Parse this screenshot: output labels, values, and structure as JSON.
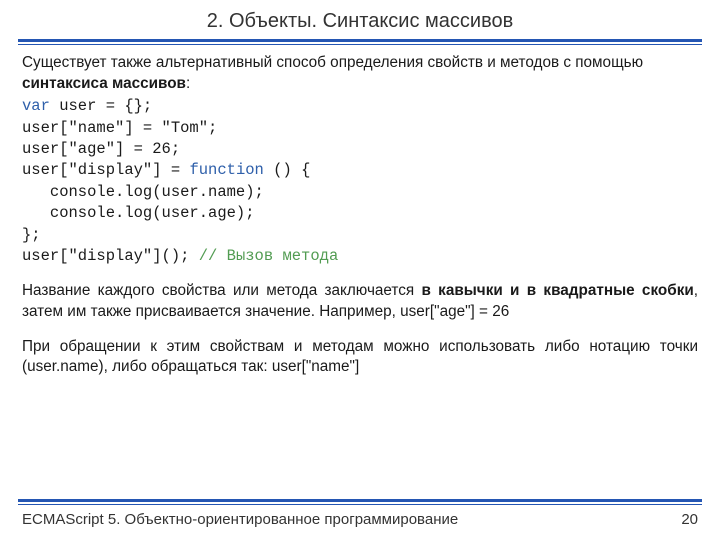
{
  "title": "2. Объекты. Синтаксис массивов",
  "intro_a": "Существует также альтернативный способ определения свойств и методов с помощью ",
  "intro_b": "синтаксиса массивов",
  "intro_c": ":",
  "code": {
    "l1a": "var",
    "l1b": " user = {};",
    "l2": "user[\"name\"] = \"Tom\";",
    "l3": "user[\"age\"] = 26;",
    "l4a": "user[\"display\"] = ",
    "l4b": "function",
    "l4c": " () {",
    "l5": "   console.log(user.name);",
    "l6": "   console.log(user.age);",
    "l7": "};",
    "l8a": "user[\"display\"](); ",
    "l8b": "// Вызов метода"
  },
  "p2a": "Название каждого свойства или метода заключается ",
  "p2b": "в кавычки и в квадратные скобки",
  "p2c": ", затем им также присваивается значение. Например, user[\"age\"] = 26",
  "p3": "При обращении к этим свойствам и методам можно использовать либо нотацию точки (user.name), либо обращаться так: user[\"name\"]",
  "footer_left": "ECMAScript 5. Объектно-ориентированное программирование",
  "footer_right": "20"
}
